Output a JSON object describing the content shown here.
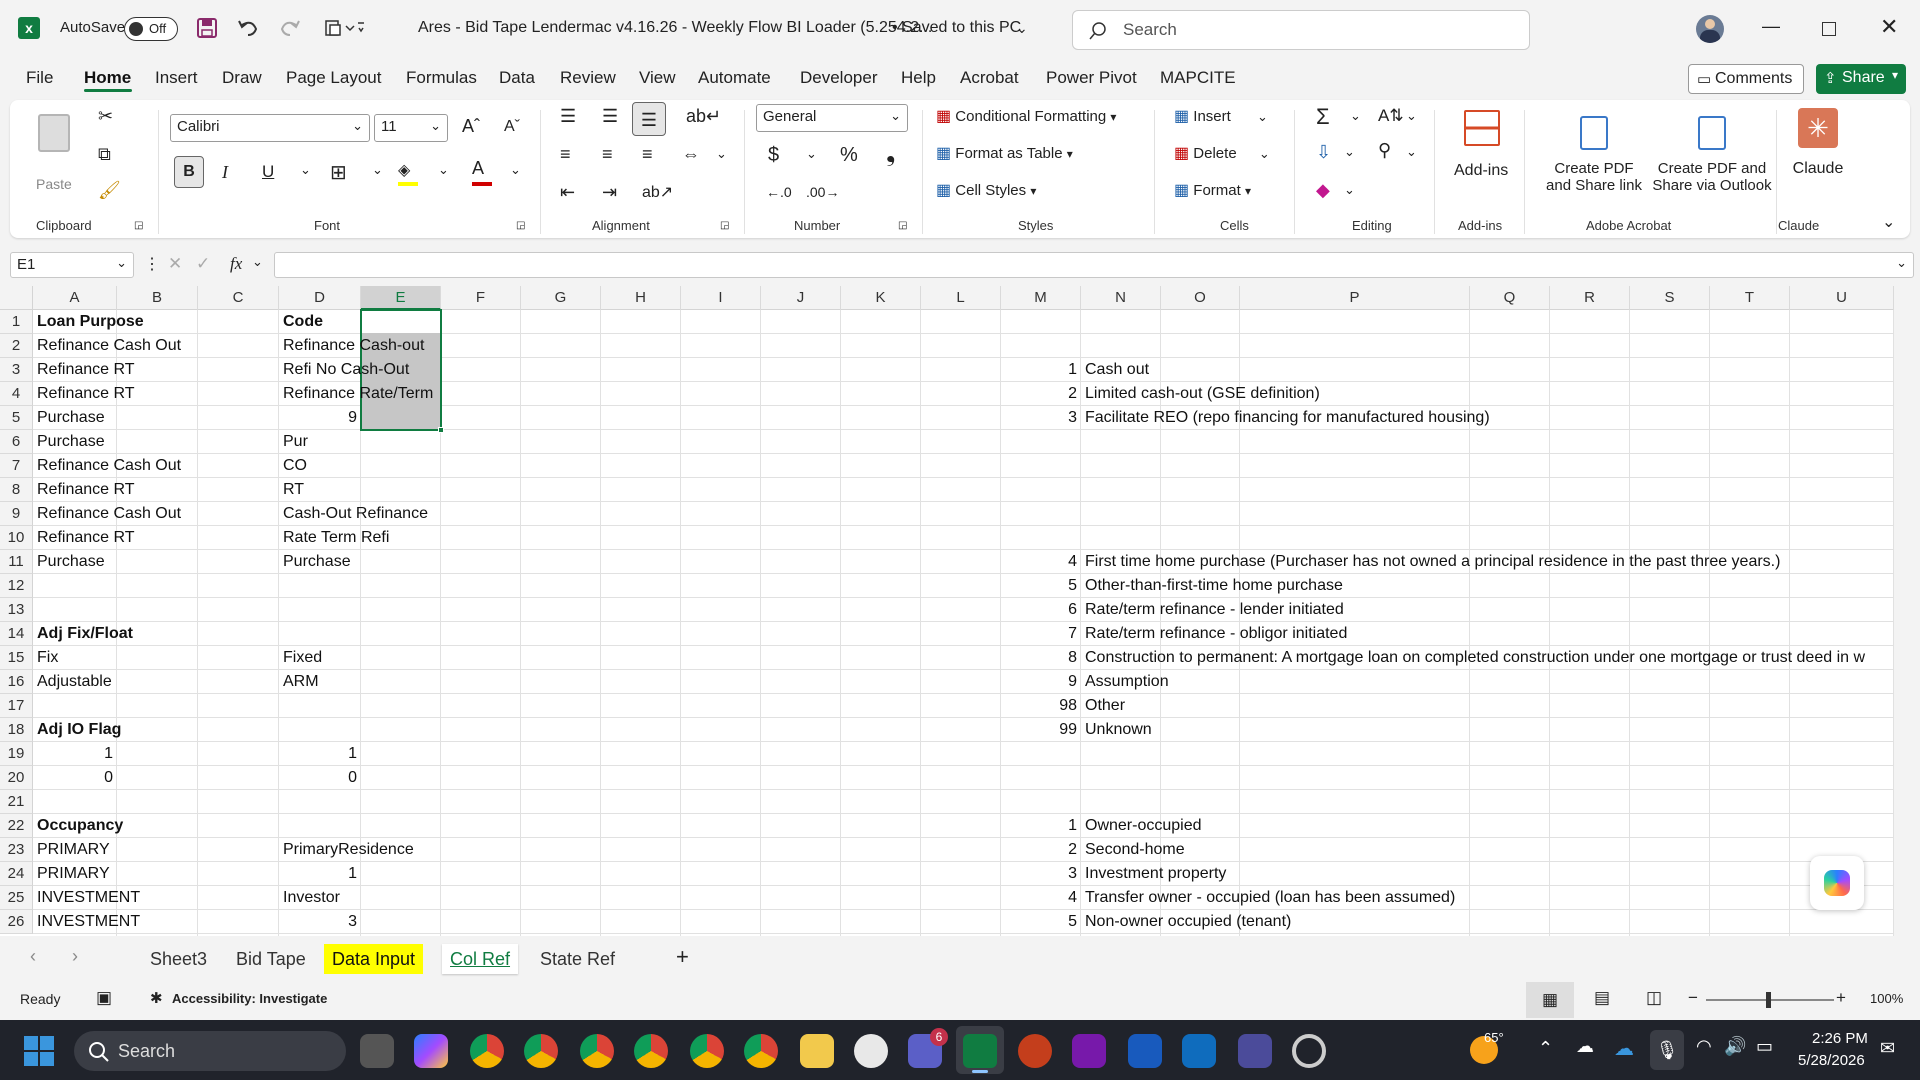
{
  "titlebar": {
    "autosave_label": "AutoSave",
    "autosave_state": "Off",
    "file_title": "Ares - Bid Tape Lendermac v4.16.26 - Weekly Flow BI Loader (5.254.2...",
    "save_status": "• Saved to this PC",
    "search_placeholder": "Search"
  },
  "menu": {
    "items": [
      "File",
      "Home",
      "Insert",
      "Draw",
      "Page Layout",
      "Formulas",
      "Data",
      "Review",
      "View",
      "Automate",
      "Developer",
      "Help",
      "Acrobat",
      "Power Pivot",
      "MAPCITE"
    ],
    "comments": "Comments",
    "share": "Share"
  },
  "ribbon": {
    "clipboard": {
      "paste": "Paste",
      "group": "Clipboard"
    },
    "font": {
      "name": "Calibri",
      "size": "11",
      "bold": "B",
      "italic": "I",
      "underline": "U",
      "group": "Font"
    },
    "alignment": {
      "group": "Alignment"
    },
    "number": {
      "format": "General",
      "currency": "$",
      "percent": "%",
      "comma": "❟",
      "group": "Number"
    },
    "styles": {
      "conditional": "Conditional Formatting",
      "table": "Format as Table",
      "cell": "Cell Styles",
      "group": "Styles"
    },
    "cells": {
      "insert": "Insert",
      "delete": "Delete",
      "format": "Format",
      "group": "Cells"
    },
    "editing": {
      "group": "Editing"
    },
    "addins": {
      "label": "Add-ins",
      "group": "Add-ins"
    },
    "acrobat": {
      "create_pdf_share": "Create PDF",
      "create_pdf_share2": "and Share link",
      "create_pdf_outlook": "Create PDF and",
      "create_pdf_outlook2": "Share via Outlook",
      "group": "Adobe Acrobat"
    },
    "claude": {
      "label": "Claude",
      "group": "Claude"
    }
  },
  "formula_bar": {
    "name_box": "E1",
    "fx": "fx",
    "formula": ""
  },
  "columns": [
    "A",
    "B",
    "C",
    "D",
    "E",
    "F",
    "G",
    "H",
    "I",
    "J",
    "K",
    "L",
    "M",
    "N",
    "O",
    "P",
    "Q",
    "R",
    "S",
    "T",
    "U"
  ],
  "rows": [
    "1",
    "2",
    "3",
    "4",
    "5",
    "6",
    "7",
    "8",
    "9",
    "10",
    "11",
    "12",
    "13",
    "14",
    "15",
    "16",
    "17",
    "18",
    "19",
    "20",
    "21",
    "22",
    "23",
    "24",
    "25",
    "26"
  ],
  "cells": {
    "A": [
      "Loan Purpose",
      "Refinance Cash Out",
      "Refinance RT",
      "Refinance RT",
      "Purchase",
      "Purchase",
      "Refinance Cash Out",
      "Refinance RT",
      "Refinance Cash Out",
      "Refinance RT",
      "Purchase",
      "",
      "",
      "Adj Fix/Float",
      "Fix",
      "Adjustable",
      "",
      "Adj IO Flag",
      "1",
      "0",
      "",
      "Occupancy",
      "PRIMARY",
      "PRIMARY",
      "INVESTMENT",
      "INVESTMENT"
    ],
    "D": [
      "Code",
      "Refinance Cash-out",
      "Refi No Cash-Out",
      "Refinance Rate/Term",
      "9",
      "Pur",
      "CO",
      "RT",
      "Cash-Out Refinance",
      "Rate Term Refi",
      "Purchase",
      "",
      "",
      "",
      "Fixed",
      "ARM",
      "",
      "",
      "1",
      "0",
      "",
      "",
      "PrimaryResidence",
      "1",
      "Investor",
      "3"
    ],
    "M": [
      "",
      "",
      "1",
      "2",
      "3",
      "",
      "",
      "",
      "",
      "",
      "4",
      "5",
      "6",
      "7",
      "8",
      "9",
      "98",
      "99",
      "",
      "",
      "",
      "1",
      "2",
      "3",
      "4",
      "5"
    ],
    "N": [
      "",
      "",
      "Cash out",
      "Limited cash-out (GSE definition)",
      "Facilitate REO (repo financing for manufactured housing)",
      "",
      "",
      "",
      "",
      "",
      "First time home purchase (Purchaser has not owned a principal residence in the past three years.)",
      "Other-than-first-time home purchase",
      "Rate/term refinance - lender initiated",
      "Rate/term refinance - obligor initiated",
      "Construction to permanent: A mortgage loan on completed construction under one mortgage or trust deed in w",
      "Assumption",
      "Other",
      "Unknown",
      "",
      "",
      "",
      "Owner-occupied",
      "Second-home",
      "Investment property",
      "Transfer owner - occupied (loan has been assumed)",
      "Non-owner occupied (tenant)"
    ]
  },
  "sheet_tabs": [
    "Sheet3",
    "Bid Tape",
    "Data Input",
    "Col Ref",
    "State Ref"
  ],
  "active_sheet": "Col Ref",
  "highlight_sheet": "Data Input",
  "status": {
    "ready": "Ready",
    "accessibility": "Accessibility: Investigate",
    "zoom": "100%"
  },
  "taskbar": {
    "search": "Search",
    "weather": "65°",
    "time": "2:26 PM",
    "date": "5/28/2026",
    "teams_badge": "6"
  },
  "colors": {
    "excel_green": "#107c41",
    "highlight": "#ffff00",
    "selection": "#c6c6c6",
    "taskbar": "#20232b"
  }
}
